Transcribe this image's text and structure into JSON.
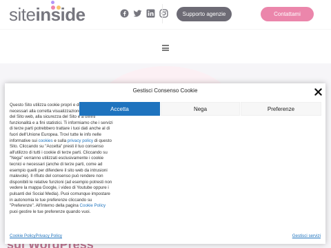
{
  "header": {
    "logo": {
      "site": "site",
      "inside": "inside"
    },
    "social_icons": [
      "facebook-icon",
      "twitter-icon",
      "linkedin-icon",
      "instagram-icon"
    ],
    "support_button": "Supporto agenzie",
    "contact_button": "Contattami"
  },
  "hero": {
    "text": "sul WordPress"
  },
  "consent": {
    "title": "Gestisci Consenso Cookie",
    "accept_label": "Accetta",
    "deny_label": "Nega",
    "preferences_label": "Preferenze",
    "message_part1": "Questo Sito utilizza cookie propri e di terze parti, necessari alla corretta visualizzazione e navigazione del Sito web, alla sicurezza del Sito e a offrirti funzionalità e a fini statistici. Ti informiamo che i servizi di terze parti potrebbero trattare i tuoi dati anche al di fuori dell'Unione Europea. Trovi tutte le info nelle informative sui ",
    "cookies_link": "cookies",
    "message_part2": " e sulla ",
    "privacy_link": "privacy policy",
    "message_part3": " di questo Sito. Cliccando su \"Accetta\" presti il tuo consenso all'utilizzo di tutti i cookie di terze parti. Cliccando su \"Nega\" verranno utilizzati esclusivamente i cookie tecnici e necessari (anche di terze parti, come ad esempio quelli per difendere il sito web da intrusioni malevole). Il rifiuto del consenso può rendere non disponibili le relative funzioni (ad esempio potresti non vedere la mappa Google, i video di Youtube oppure i pulsanti dei Social Media). Puoi comunque impostare in autonomia le tue preferenze cliccando su \"Preferenze\". All'interno della pagina ",
    "cookie_policy_inline": "Cookie Policy",
    "message_part4": " puoi gestire le tue preferenze quando vuoi.",
    "footer_cookie_policy": "Cookie Policy",
    "footer_privacy_policy": "Privacy Policy",
    "footer_services": "Gestisci servizi"
  },
  "colors": {
    "accent_blue": "#1e73be",
    "brand_pink": "#e0467f",
    "dark": "#1f1d2b"
  }
}
